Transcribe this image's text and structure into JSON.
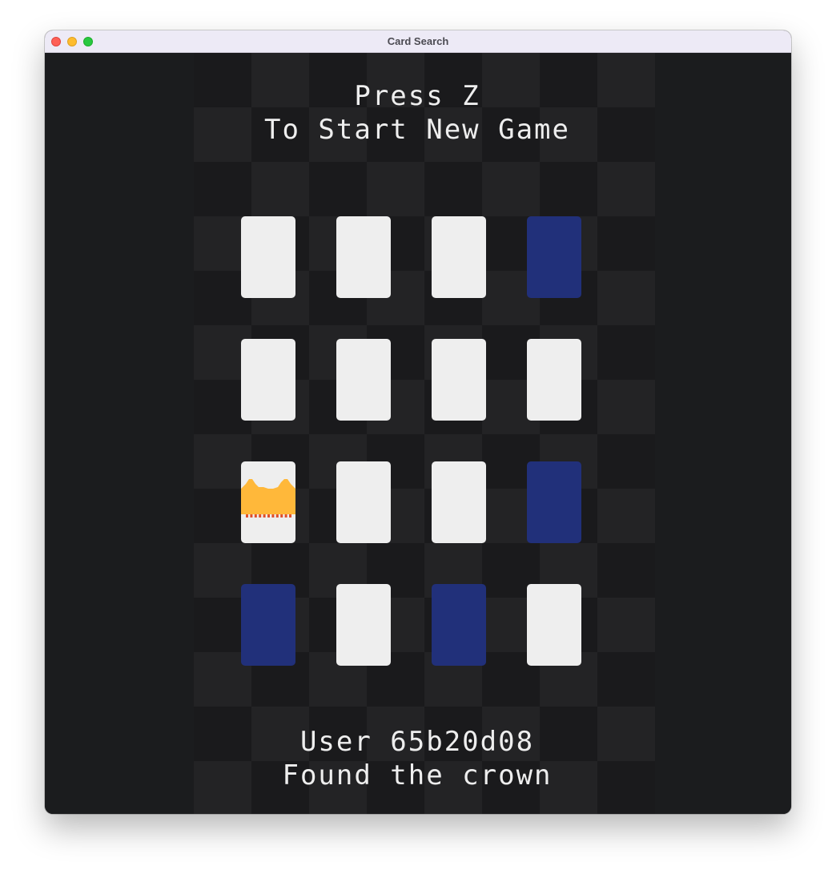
{
  "window": {
    "title": "Card Search"
  },
  "game": {
    "prompt_line1": "Press Z",
    "prompt_line2": "To Start New Game",
    "status_line1": "User 65b20d08",
    "status_line2": "Found the crown",
    "colors": {
      "background": "#1b1c1e",
      "checker_light": "#232325",
      "checker_dark": "#1a1a1c",
      "card_face_down": "#eeeeee",
      "card_revealed": "#21307a",
      "crown": "#ffb83a",
      "crown_band": "#e0502a",
      "text": "#eeeeee"
    },
    "grid": {
      "rows": 4,
      "cols": 4,
      "cards": [
        [
          "face-down",
          "face-down",
          "face-down",
          "revealed-empty"
        ],
        [
          "face-down",
          "face-down",
          "face-down",
          "face-down"
        ],
        [
          "crown",
          "face-down",
          "face-down",
          "revealed-empty"
        ],
        [
          "revealed-empty",
          "face-down",
          "revealed-empty",
          "face-down"
        ]
      ]
    }
  }
}
